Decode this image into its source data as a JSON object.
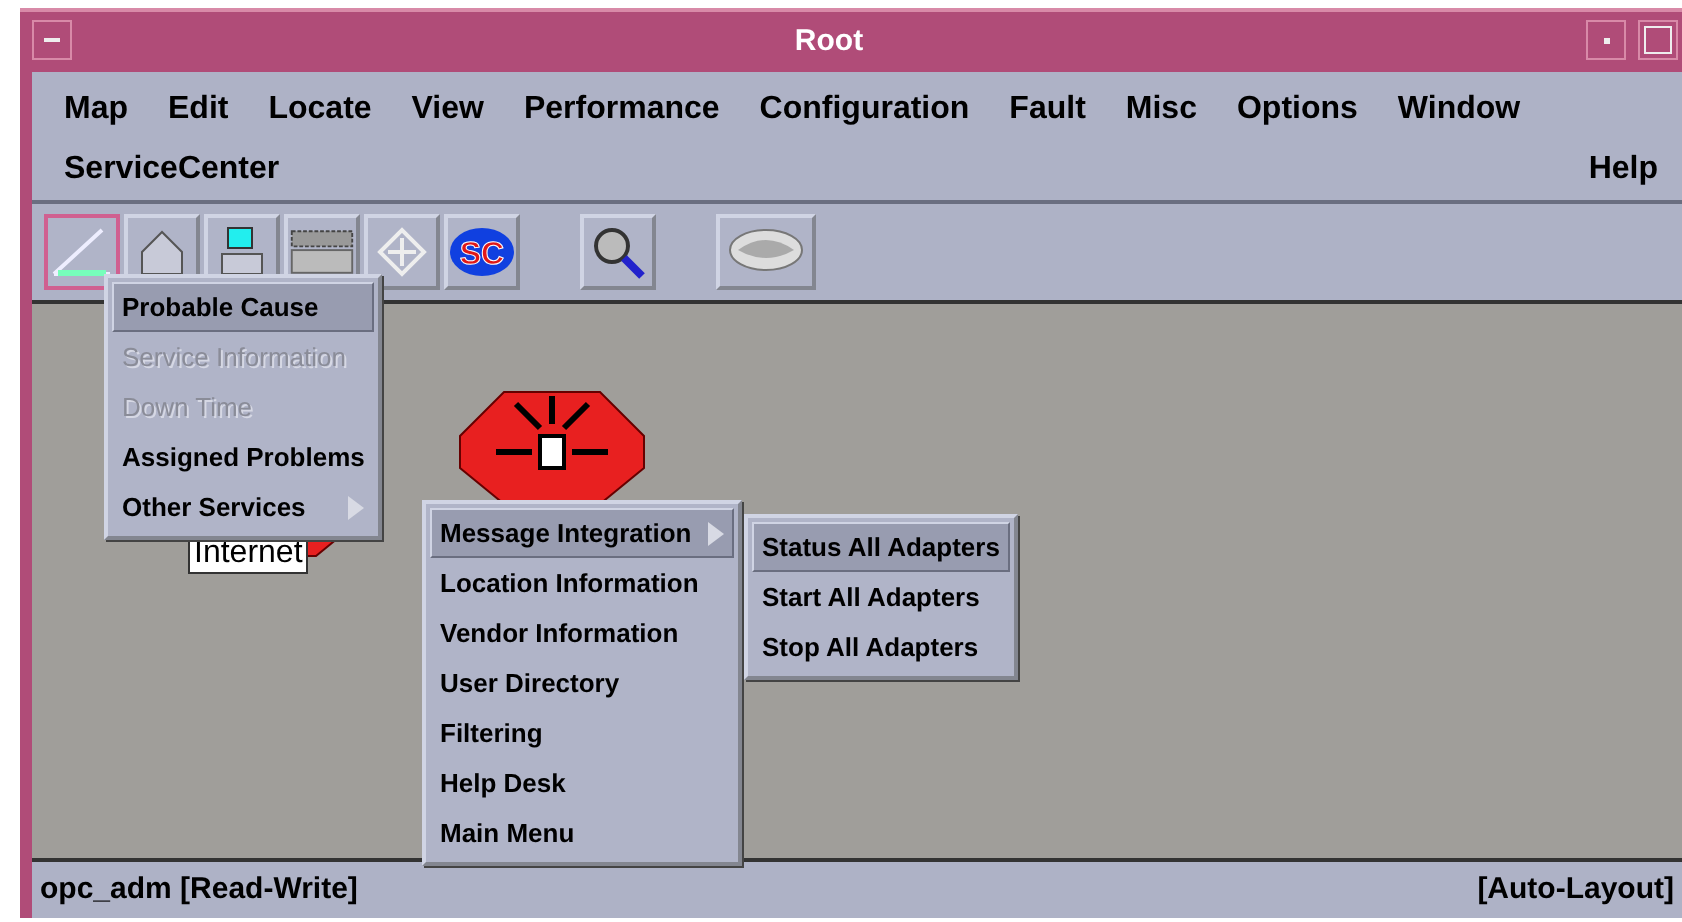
{
  "window": {
    "title": "Root"
  },
  "menu_bar": [
    "Map",
    "Edit",
    "Locate",
    "View",
    "Performance",
    "Configuration",
    "Fault",
    "Misc",
    "Options",
    "Window"
  ],
  "menu_bar_row2": {
    "service_menu": "ServiceCenter",
    "help_menu": "Help"
  },
  "toolbar": [
    {
      "kind": "triangle",
      "selected": true
    },
    {
      "kind": "house",
      "selected": false
    },
    {
      "kind": "monitor",
      "selected": false
    },
    {
      "kind": "grid",
      "selected": false
    },
    {
      "kind": "arrows",
      "selected": false
    },
    {
      "kind": "sc-logo",
      "selected": false,
      "label": "SC"
    },
    {
      "kind": "magnifier",
      "selected": false
    },
    {
      "kind": "hands",
      "selected": false
    }
  ],
  "map": {
    "nodes": [
      {
        "kind": "globe",
        "label": "Internet"
      },
      {
        "kind": "alert"
      }
    ]
  },
  "context_menu": [
    {
      "label": "Probable Cause",
      "selected": true,
      "disabled": false
    },
    {
      "label": "Service Information",
      "selected": false,
      "disabled": true
    },
    {
      "label": "Down Time",
      "selected": false,
      "disabled": true
    },
    {
      "label": "Assigned Problems",
      "selected": false,
      "disabled": false
    },
    {
      "label": "Other Services",
      "selected": false,
      "disabled": false,
      "children": [
        {
          "label": "Message Integration",
          "selected": true,
          "disabled": false,
          "children": [
            {
              "label": "Status All Adapters",
              "selected": true,
              "disabled": false
            },
            {
              "label": "Start All Adapters",
              "selected": false,
              "disabled": false
            },
            {
              "label": "Stop All Adapters",
              "selected": false,
              "disabled": false
            }
          ]
        },
        {
          "label": "Location Information",
          "selected": false,
          "disabled": false
        },
        {
          "label": "Vendor Information",
          "selected": false,
          "disabled": false
        },
        {
          "label": "User Directory",
          "selected": false,
          "disabled": false
        },
        {
          "label": "Filtering",
          "selected": false,
          "disabled": false
        },
        {
          "label": "Help Desk",
          "selected": false,
          "disabled": false
        },
        {
          "label": "Main Menu",
          "selected": false,
          "disabled": false
        }
      ]
    }
  ],
  "status_bar": {
    "left": "opc_adm [Read-Write]",
    "right": "[Auto-Layout]"
  }
}
